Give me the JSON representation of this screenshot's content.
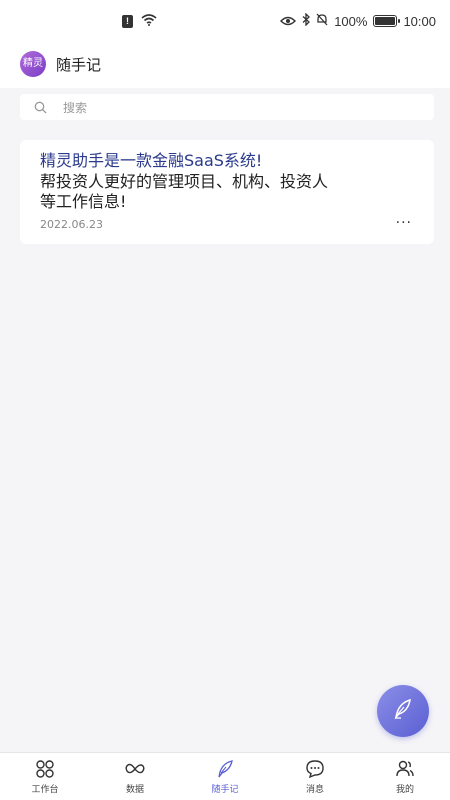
{
  "status_bar": {
    "battery": "100%",
    "time": "10:00",
    "battery_level": 1.0,
    "icons": [
      "sim-alert-icon",
      "wifi-icon",
      "eye-icon",
      "bluetooth-icon",
      "mute-icon",
      "battery-icon"
    ]
  },
  "header": {
    "logo_text": "精灵",
    "title": "随手记"
  },
  "search": {
    "placeholder": "搜索"
  },
  "notes": [
    {
      "title": "精灵助手是一款金融SaaS系统!",
      "body": "帮投资人更好的管理项目、机构、投资人\n等工作信息!",
      "date": "2022.06.23",
      "more_icon": "more-icon"
    }
  ],
  "fab": {
    "icon": "feather-pen-icon"
  },
  "tab_bar": {
    "tabs": [
      {
        "label": "工作台",
        "icon": "workbench-grid-icon"
      },
      {
        "label": "数据",
        "icon": "infinity-icon"
      },
      {
        "label": "随手记",
        "icon": "feather-icon"
      },
      {
        "label": "消息",
        "icon": "chat-bubble-icon"
      },
      {
        "label": "我的",
        "icon": "users-icon"
      }
    ],
    "active_index": 2
  },
  "colors": {
    "accent": "#5a5fd3",
    "note_title": "#2a3a8c",
    "background": "#f5f5f7"
  }
}
